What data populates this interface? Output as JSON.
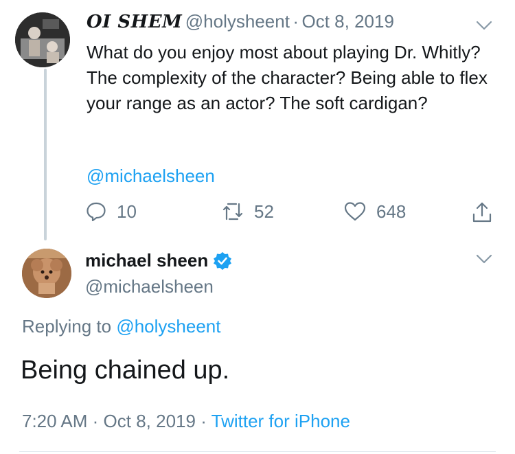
{
  "tweet1": {
    "display_name": "OI SHEM",
    "handle": "@holysheent",
    "separator": "·",
    "date": "Oct 8, 2019",
    "text": "What do you enjoy most about playing Dr. Whitly? The complexity of the character? Being able to flex your range as an actor? The soft cardigan?",
    "mention": "@michaelsheen",
    "reply_count": "10",
    "retweet_count": "52",
    "like_count": "648"
  },
  "tweet2": {
    "display_name": "michael sheen",
    "handle": "@michaelsheen",
    "replying_prefix": "Replying to",
    "replying_to": "@holysheent",
    "text": "Being chained up.",
    "time": "7:20 AM",
    "separator": "·",
    "date": "Oct 8, 2019",
    "separator2": "·",
    "source": "Twitter for iPhone"
  },
  "colors": {
    "accent": "#1da1f2",
    "muted": "#657786",
    "text": "#14171a",
    "verified": "#1da1f2"
  },
  "icons": [
    "reply-icon",
    "retweet-icon",
    "like-icon",
    "share-icon",
    "chevron-down-icon",
    "verified-badge-icon"
  ]
}
